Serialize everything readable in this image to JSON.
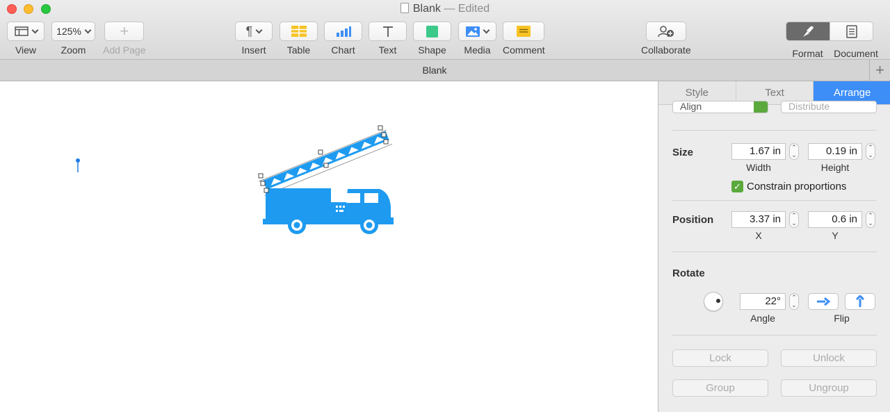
{
  "window": {
    "doc_title": "Blank",
    "edited_suffix": "— Edited"
  },
  "toolbar": {
    "view": {
      "label": "View"
    },
    "zoom": {
      "label": "Zoom",
      "value": "125%"
    },
    "add_page": {
      "label": "Add Page"
    },
    "insert": {
      "label": "Insert"
    },
    "table": {
      "label": "Table"
    },
    "chart": {
      "label": "Chart"
    },
    "text": {
      "label": "Text"
    },
    "shape": {
      "label": "Shape"
    },
    "media": {
      "label": "Media"
    },
    "comment": {
      "label": "Comment"
    },
    "collaborate": {
      "label": "Collaborate"
    },
    "format": {
      "label": "Format"
    },
    "document": {
      "label": "Document"
    }
  },
  "tabbar": {
    "title": "Blank"
  },
  "inspector": {
    "tabs": [
      {
        "label": "Style",
        "active": false
      },
      {
        "label": "Text",
        "active": false
      },
      {
        "label": "Arrange",
        "active": true
      }
    ],
    "align": {
      "value": "Align"
    },
    "distribute": {
      "value": "Distribute"
    },
    "size": {
      "label": "Size",
      "width": "1.67 in",
      "width_label": "Width",
      "height": "0.19 in",
      "height_label": "Height",
      "constrain_label": "Constrain proportions",
      "constrain_checked": true
    },
    "position": {
      "label": "Position",
      "x": "3.37 in",
      "x_label": "X",
      "y": "0.6 in",
      "y_label": "Y"
    },
    "rotate": {
      "label": "Rotate",
      "angle": "22°",
      "angle_label": "Angle",
      "flip_label": "Flip"
    },
    "buttons": {
      "lock": "Lock",
      "unlock": "Unlock",
      "group": "Group",
      "ungroup": "Ungroup"
    }
  },
  "colors": {
    "accent": "#3d8ef7",
    "truck": "#1e9bf0",
    "checkbox": "#5ba93c"
  }
}
